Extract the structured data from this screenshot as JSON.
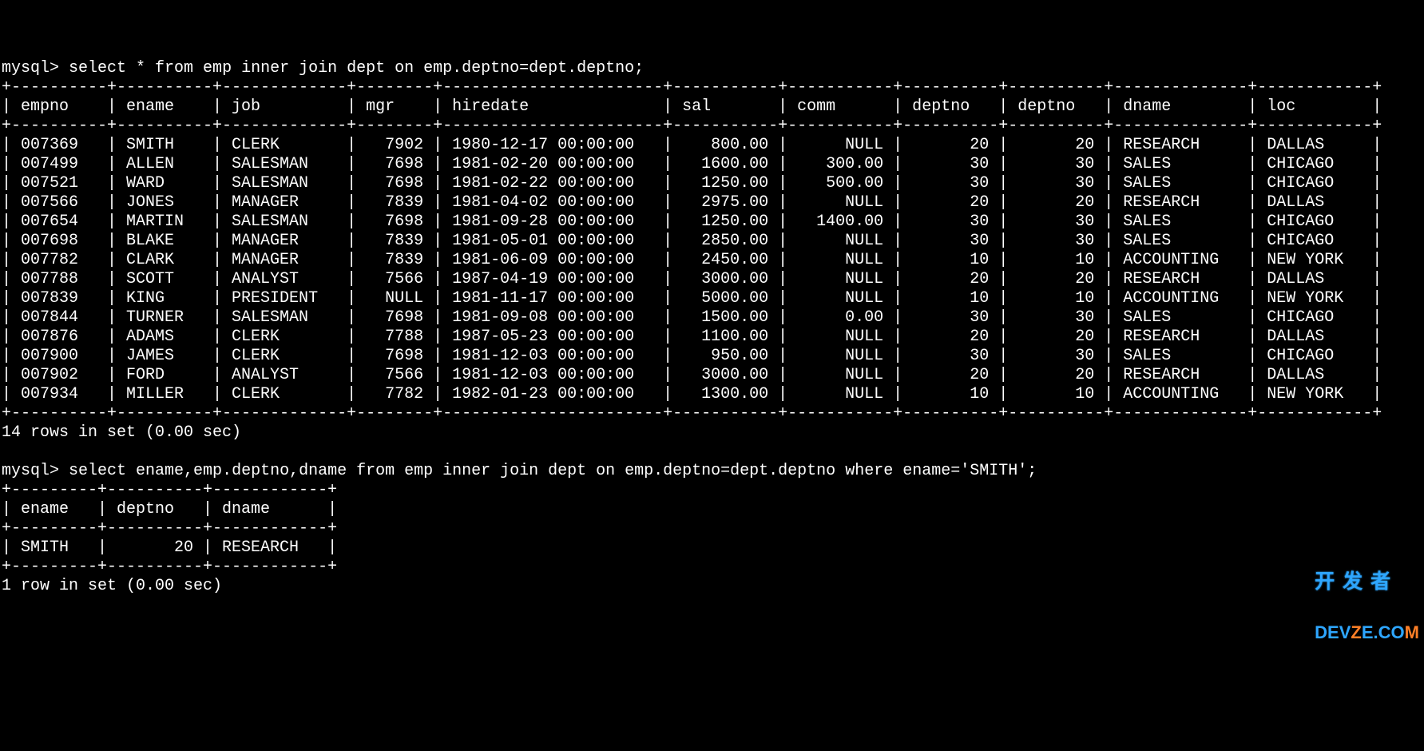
{
  "query1": {
    "prompt": "mysql>",
    "sql": "select * from emp inner join dept on emp.deptno=dept.deptno;"
  },
  "table1": {
    "columns": [
      "empno",
      "ename",
      "job",
      "mgr",
      "hiredate",
      "sal",
      "comm",
      "deptno",
      "deptno",
      "dname",
      "loc"
    ],
    "rows": [
      {
        "empno": "007369",
        "ename": "SMITH",
        "job": "CLERK",
        "mgr": "7902",
        "hiredate": "1980-12-17 00:00:00",
        "sal": "800.00",
        "comm": "NULL",
        "deptno1": "20",
        "deptno2": "20",
        "dname": "RESEARCH",
        "loc": "DALLAS"
      },
      {
        "empno": "007499",
        "ename": "ALLEN",
        "job": "SALESMAN",
        "mgr": "7698",
        "hiredate": "1981-02-20 00:00:00",
        "sal": "1600.00",
        "comm": "300.00",
        "deptno1": "30",
        "deptno2": "30",
        "dname": "SALES",
        "loc": "CHICAGO"
      },
      {
        "empno": "007521",
        "ename": "WARD",
        "job": "SALESMAN",
        "mgr": "7698",
        "hiredate": "1981-02-22 00:00:00",
        "sal": "1250.00",
        "comm": "500.00",
        "deptno1": "30",
        "deptno2": "30",
        "dname": "SALES",
        "loc": "CHICAGO"
      },
      {
        "empno": "007566",
        "ename": "JONES",
        "job": "MANAGER",
        "mgr": "7839",
        "hiredate": "1981-04-02 00:00:00",
        "sal": "2975.00",
        "comm": "NULL",
        "deptno1": "20",
        "deptno2": "20",
        "dname": "RESEARCH",
        "loc": "DALLAS"
      },
      {
        "empno": "007654",
        "ename": "MARTIN",
        "job": "SALESMAN",
        "mgr": "7698",
        "hiredate": "1981-09-28 00:00:00",
        "sal": "1250.00",
        "comm": "1400.00",
        "deptno1": "30",
        "deptno2": "30",
        "dname": "SALES",
        "loc": "CHICAGO"
      },
      {
        "empno": "007698",
        "ename": "BLAKE",
        "job": "MANAGER",
        "mgr": "7839",
        "hiredate": "1981-05-01 00:00:00",
        "sal": "2850.00",
        "comm": "NULL",
        "deptno1": "30",
        "deptno2": "30",
        "dname": "SALES",
        "loc": "CHICAGO"
      },
      {
        "empno": "007782",
        "ename": "CLARK",
        "job": "MANAGER",
        "mgr": "7839",
        "hiredate": "1981-06-09 00:00:00",
        "sal": "2450.00",
        "comm": "NULL",
        "deptno1": "10",
        "deptno2": "10",
        "dname": "ACCOUNTING",
        "loc": "NEW YORK"
      },
      {
        "empno": "007788",
        "ename": "SCOTT",
        "job": "ANALYST",
        "mgr": "7566",
        "hiredate": "1987-04-19 00:00:00",
        "sal": "3000.00",
        "comm": "NULL",
        "deptno1": "20",
        "deptno2": "20",
        "dname": "RESEARCH",
        "loc": "DALLAS"
      },
      {
        "empno": "007839",
        "ename": "KING",
        "job": "PRESIDENT",
        "mgr": "NULL",
        "hiredate": "1981-11-17 00:00:00",
        "sal": "5000.00",
        "comm": "NULL",
        "deptno1": "10",
        "deptno2": "10",
        "dname": "ACCOUNTING",
        "loc": "NEW YORK"
      },
      {
        "empno": "007844",
        "ename": "TURNER",
        "job": "SALESMAN",
        "mgr": "7698",
        "hiredate": "1981-09-08 00:00:00",
        "sal": "1500.00",
        "comm": "0.00",
        "deptno1": "30",
        "deptno2": "30",
        "dname": "SALES",
        "loc": "CHICAGO"
      },
      {
        "empno": "007876",
        "ename": "ADAMS",
        "job": "CLERK",
        "mgr": "7788",
        "hiredate": "1987-05-23 00:00:00",
        "sal": "1100.00",
        "comm": "NULL",
        "deptno1": "20",
        "deptno2": "20",
        "dname": "RESEARCH",
        "loc": "DALLAS"
      },
      {
        "empno": "007900",
        "ename": "JAMES",
        "job": "CLERK",
        "mgr": "7698",
        "hiredate": "1981-12-03 00:00:00",
        "sal": "950.00",
        "comm": "NULL",
        "deptno1": "30",
        "deptno2": "30",
        "dname": "SALES",
        "loc": "CHICAGO"
      },
      {
        "empno": "007902",
        "ename": "FORD",
        "job": "ANALYST",
        "mgr": "7566",
        "hiredate": "1981-12-03 00:00:00",
        "sal": "3000.00",
        "comm": "NULL",
        "deptno1": "20",
        "deptno2": "20",
        "dname": "RESEARCH",
        "loc": "DALLAS"
      },
      {
        "empno": "007934",
        "ename": "MILLER",
        "job": "CLERK",
        "mgr": "7782",
        "hiredate": "1982-01-23 00:00:00",
        "sal": "1300.00",
        "comm": "NULL",
        "deptno1": "10",
        "deptno2": "10",
        "dname": "ACCOUNTING",
        "loc": "NEW YORK"
      }
    ],
    "status": "14 rows in set (0.00 sec)",
    "col_widths": {
      "empno": 8,
      "ename": 8,
      "job": 11,
      "mgr": 6,
      "hiredate": 21,
      "sal": 9,
      "comm": 9,
      "deptno1": 8,
      "deptno2": 8,
      "dname": 12,
      "loc": 10
    },
    "col_align": {
      "empno": "left",
      "ename": "left",
      "job": "left",
      "mgr": "right",
      "hiredate": "left",
      "sal": "right",
      "comm": "right",
      "deptno1": "right",
      "deptno2": "right",
      "dname": "left",
      "loc": "left"
    }
  },
  "query2": {
    "prompt": "mysql>",
    "sql": "select ename,emp.deptno,dname from emp inner join dept on emp.deptno=dept.deptno where ename='SMITH';"
  },
  "table2": {
    "columns": [
      "ename",
      "deptno",
      "dname"
    ],
    "rows": [
      {
        "ename": "SMITH",
        "deptno": "20",
        "dname": "RESEARCH"
      }
    ],
    "status": "1 row in set (0.00 sec)",
    "col_widths": {
      "ename": 7,
      "deptno": 8,
      "dname": 10
    },
    "col_align": {
      "ename": "left",
      "deptno": "right",
      "dname": "left"
    }
  },
  "watermark": {
    "line1": "开发者",
    "line2": "DEVZE.COM"
  }
}
